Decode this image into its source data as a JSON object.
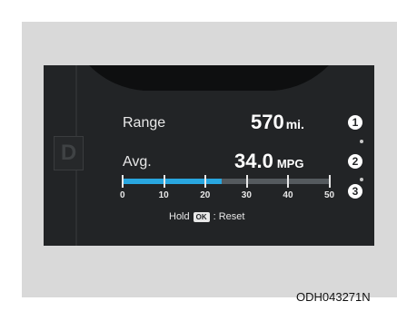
{
  "cluster": {
    "gear": "D",
    "range": {
      "label": "Range",
      "value": "570",
      "unit": "mi."
    },
    "avg": {
      "label": "Avg.",
      "value": "34.0",
      "unit": "MPG"
    },
    "bar": {
      "fill_fraction": 0.48,
      "fill_color": "#29a6df",
      "ticks": [
        "0",
        "10",
        "20",
        "30",
        "40",
        "50"
      ]
    },
    "hold": {
      "prefix": "Hold",
      "key": "OK",
      "suffix": ": Reset"
    },
    "callouts": [
      "1",
      "2",
      "3"
    ]
  },
  "figure_code": "ODH043271N"
}
